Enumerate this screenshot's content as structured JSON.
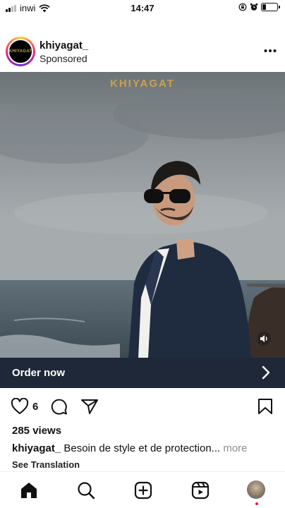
{
  "status_bar": {
    "carrier": "inwi",
    "time": "14:47",
    "battery_level": 0.25
  },
  "post": {
    "username": "khiyagat_",
    "subtitle": "Sponsored",
    "avatar_text": "KHIYAGAT",
    "media_watermark": "KHIYAGAT",
    "cta_label": "Order now",
    "likes_count": "6",
    "views": "285 views",
    "caption_user": "khiyagat_",
    "caption_text": " Besoin de style et de protection...",
    "caption_more": " more",
    "see_translation": "See Translation"
  },
  "icons": {
    "header": [
      "more-icon"
    ],
    "actions": [
      "heart-icon",
      "comment-icon",
      "share-icon",
      "bookmark-icon"
    ],
    "nav": [
      "home-icon",
      "search-icon",
      "create-icon",
      "reels-icon",
      "profile-avatar"
    ]
  },
  "colors": {
    "cta_background": "#1e2838",
    "watermark_gold": "#c9a24f",
    "notification_dot": "#ed1c45",
    "more_link": "#8e8e8e"
  }
}
